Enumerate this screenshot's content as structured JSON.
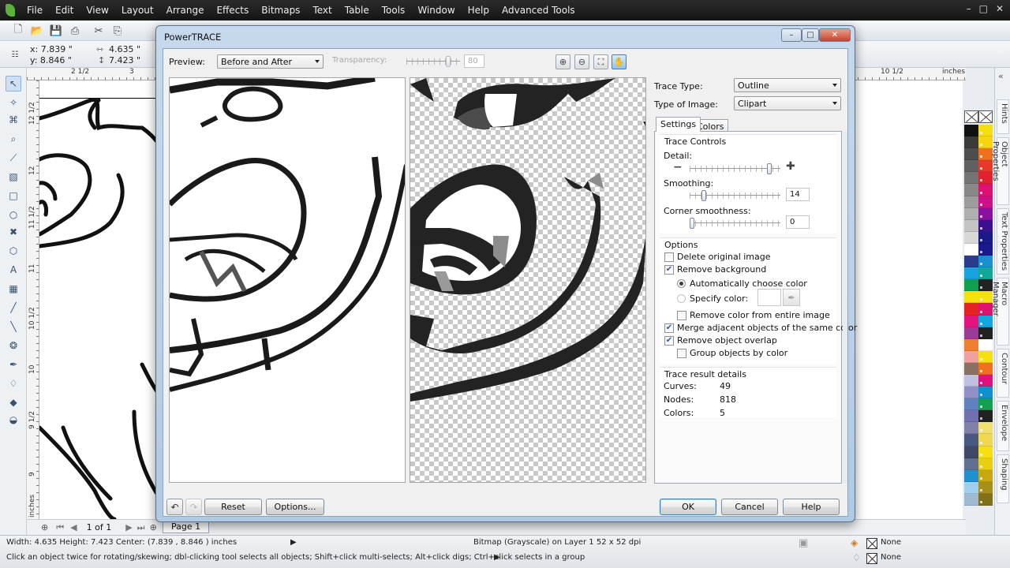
{
  "app": {
    "menu": [
      "File",
      "Edit",
      "View",
      "Layout",
      "Arrange",
      "Effects",
      "Bitmaps",
      "Text",
      "Table",
      "Tools",
      "Window",
      "Help",
      "Advanced Tools"
    ],
    "window_controls": {
      "minimize": "–",
      "restore": "□",
      "close": "✕"
    }
  },
  "property_bar": {
    "x": "x: 7.839 \"",
    "y": "y: 8.846 \"",
    "width": "4.635 \"",
    "height": "7.423 \""
  },
  "rulers": {
    "h_labels": [
      "2 1/2",
      "3",
      "10 1/2"
    ],
    "units": "inches",
    "v_labels": [
      "12 1/2",
      "12",
      "11 1/2",
      "11",
      "10 1/2",
      "10",
      "9 1/2",
      "9"
    ],
    "v_units": "inches"
  },
  "page_nav": {
    "page_count": "1 of 1",
    "page_tab": "Page 1"
  },
  "statusbar": {
    "dimensions": "Width: 4.635  Height: 7.423  Center: (7.839 , 8.846 )  inches",
    "object_info": "Bitmap (Grayscale) on Layer 1 52 x 52 dpi",
    "hint": "Click an object twice for rotating/skewing; dbl-clicking tool selects all objects; Shift+click multi-selects; Alt+click digs; Ctrl+click selects in a group",
    "fill": "None",
    "outline": "None"
  },
  "dockers": [
    "Hints",
    "Object Properties",
    "Text Properties",
    "Macro Manager",
    "Contour",
    "Envelope",
    "Shaping"
  ],
  "palette_gray": [
    "#111111",
    "#3a3a3a",
    "#4d4d4d",
    "#606060",
    "#747474",
    "#888888",
    "#9c9c9c",
    "#b0b0b0",
    "#c4c4c4",
    "#d8d8d8",
    "#ffffff",
    "#2a3a8c",
    "#16a3e0",
    "#10a050",
    "#f5e20c",
    "#e42323",
    "#e5137e",
    "#9c3b96",
    "#f08030",
    "#f0a0a0",
    "#8a7060",
    "#c0c0e0",
    "#9090c8",
    "#6080c0",
    "#7070b0",
    "#8080a8",
    "#485880",
    "#404868",
    "#607090",
    "#2090d0",
    "#a0d0f0",
    "#a0b8d0"
  ],
  "palette_color": [
    "#f5dd10",
    "#f5d510",
    "#f07020",
    "#e83828",
    "#e22030",
    "#e01070",
    "#d0108a",
    "#8a10a0",
    "#3a1090",
    "#1a1a8a",
    "#1a1a90",
    "#1890d0",
    "#10a898",
    "#222222",
    "#f5e010",
    "#e01070",
    "#10a8e0",
    "#222222",
    "#ffffff",
    "#f5e010",
    "#f07020",
    "#e01080",
    "#1090d0",
    "#10a050",
    "#222222",
    "#f0e070",
    "#f0d850",
    "#f5e010",
    "#e8d010",
    "#c8a810",
    "#a89018",
    "#807018"
  ],
  "dialog": {
    "title": "PowerTRACE",
    "preview_label": "Preview:",
    "preview_mode": "Before and After",
    "transparency_label": "Transparency:",
    "transparency_value": "80",
    "transparency_fraction": 0.8,
    "zoom_tools": [
      {
        "name": "zoom-in",
        "glyph": "⊕"
      },
      {
        "name": "zoom-out",
        "glyph": "⊖"
      },
      {
        "name": "fit",
        "glyph": "⛶"
      },
      {
        "name": "pan",
        "glyph": "✋"
      }
    ],
    "trace_type_label": "Trace Type:",
    "trace_type": "Outline",
    "image_type_label": "Type of Image:",
    "image_type": "Clipart",
    "tabs": [
      "Settings",
      "Colors"
    ],
    "trace_controls_title": "Trace Controls",
    "detail_label": "Detail:",
    "detail_fraction": 0.9,
    "smoothing_label": "Smoothing:",
    "smoothing_value": "14",
    "smoothing_fraction": 0.14,
    "corner_label": "Corner smoothness:",
    "corner_value": "0",
    "corner_fraction": 0,
    "options_title": "Options",
    "options": {
      "delete_original": {
        "label": "Delete original image",
        "checked": false
      },
      "remove_background": {
        "label": "Remove background",
        "checked": true
      },
      "auto_color": {
        "label": "Automatically choose color",
        "selected": true
      },
      "specify_color": {
        "label": "Specify color:",
        "selected": false
      },
      "remove_color_entire": {
        "label": "Remove color from entire image",
        "checked": false
      },
      "merge_adjacent": {
        "label": "Merge adjacent objects of the same color",
        "checked": true
      },
      "remove_overlap": {
        "label": "Remove object overlap",
        "checked": true
      },
      "group_by_color": {
        "label": "Group objects by color",
        "checked": false
      }
    },
    "results_title": "Trace result details",
    "results": [
      {
        "label": "Curves:",
        "value": "49"
      },
      {
        "label": "Nodes:",
        "value": "818"
      },
      {
        "label": "Colors:",
        "value": "5"
      }
    ],
    "buttons": {
      "reset": "Reset",
      "options": "Options...",
      "ok": "OK",
      "cancel": "Cancel",
      "help": "Help"
    }
  }
}
